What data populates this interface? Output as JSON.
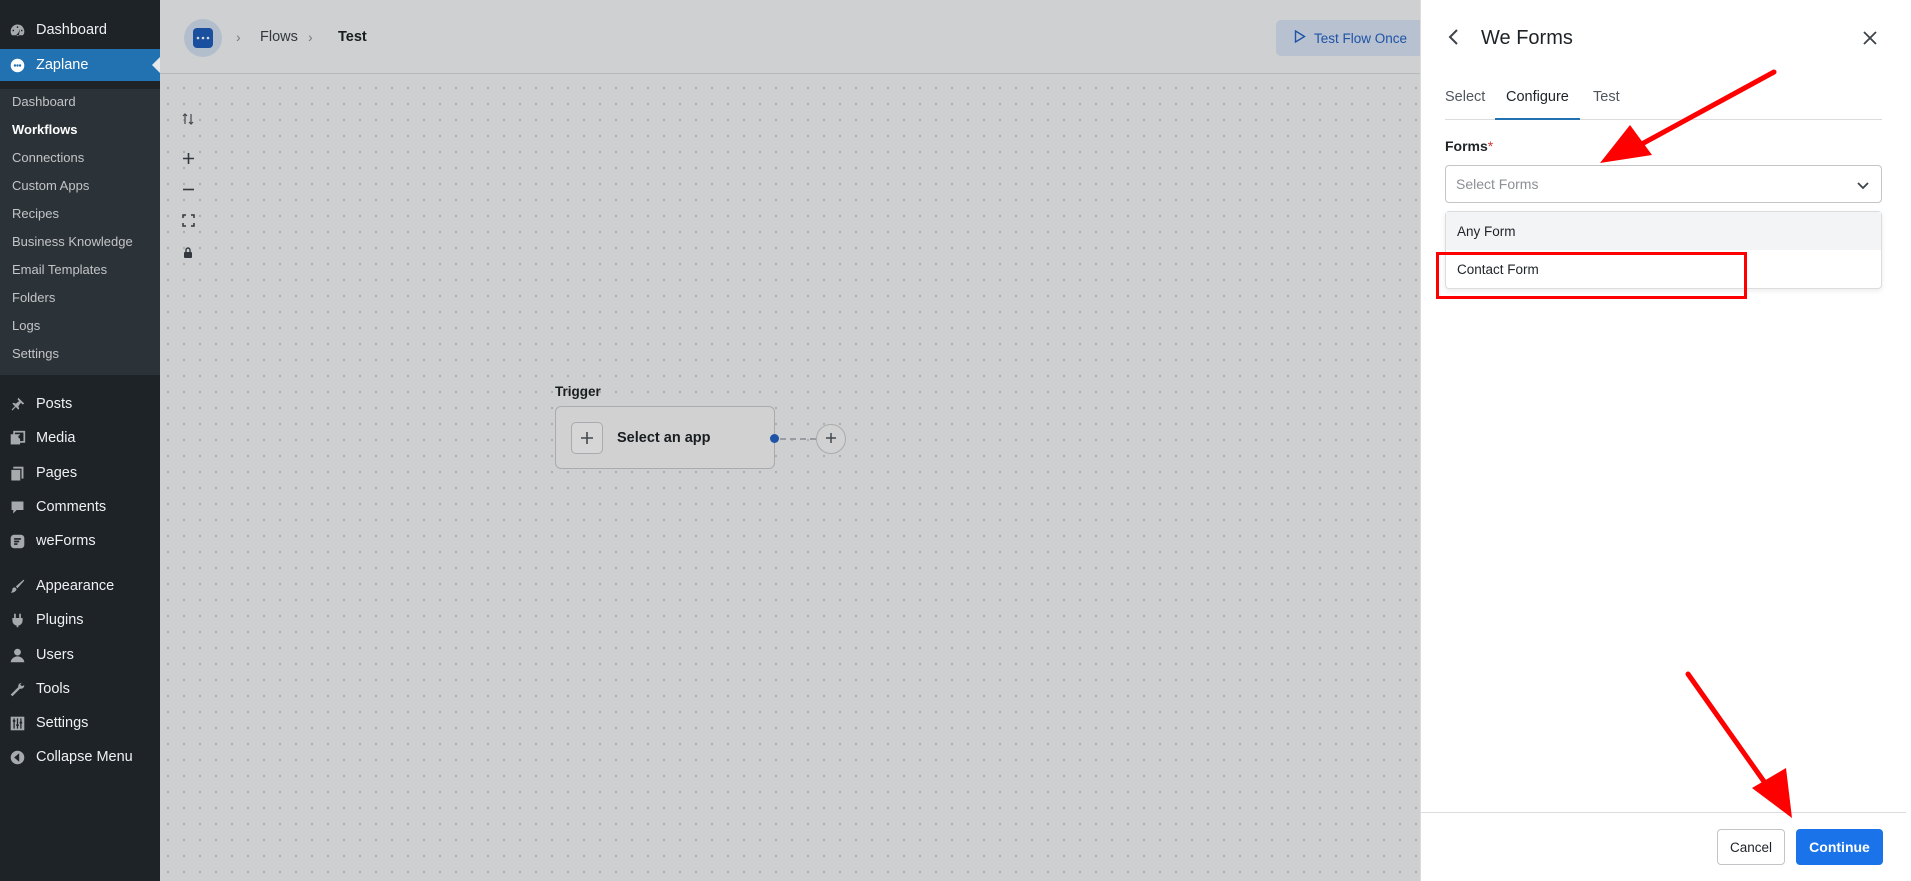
{
  "wp_menu": {
    "dashboard": "Dashboard",
    "zaplane": "Zaplane",
    "submenu": [
      "Dashboard",
      "Workflows",
      "Connections",
      "Custom Apps",
      "Recipes",
      "Business Knowledge",
      "Email Templates",
      "Folders",
      "Logs",
      "Settings"
    ],
    "posts": "Posts",
    "media": "Media",
    "pages": "Pages",
    "comments": "Comments",
    "weforms": "weForms",
    "appearance": "Appearance",
    "plugins": "Plugins",
    "users": "Users",
    "tools": "Tools",
    "settings": "Settings",
    "collapse": "Collapse Menu"
  },
  "topbar": {
    "breadcrumb": [
      "Flows",
      "Test"
    ],
    "test_flow_label": "Test Flow Once"
  },
  "canvas": {
    "trigger_label": "Trigger",
    "trigger_card_text": "Select an app"
  },
  "panel": {
    "title": "We Forms",
    "tabs": [
      {
        "label": "Select"
      },
      {
        "label": "Configure",
        "active": true
      },
      {
        "label": "Test"
      }
    ],
    "forms_label": "Forms",
    "required_mark": "*",
    "select_placeholder": "Select Forms",
    "dropdown_options": [
      "Any Form",
      "Contact Form"
    ],
    "cancel_label": "Cancel",
    "continue_label": "Continue"
  },
  "colors": {
    "wp_sidebar": "#1d2327",
    "wp_active": "#2271b1",
    "primary": "#1a73e8",
    "annotation": "#ff0000"
  }
}
